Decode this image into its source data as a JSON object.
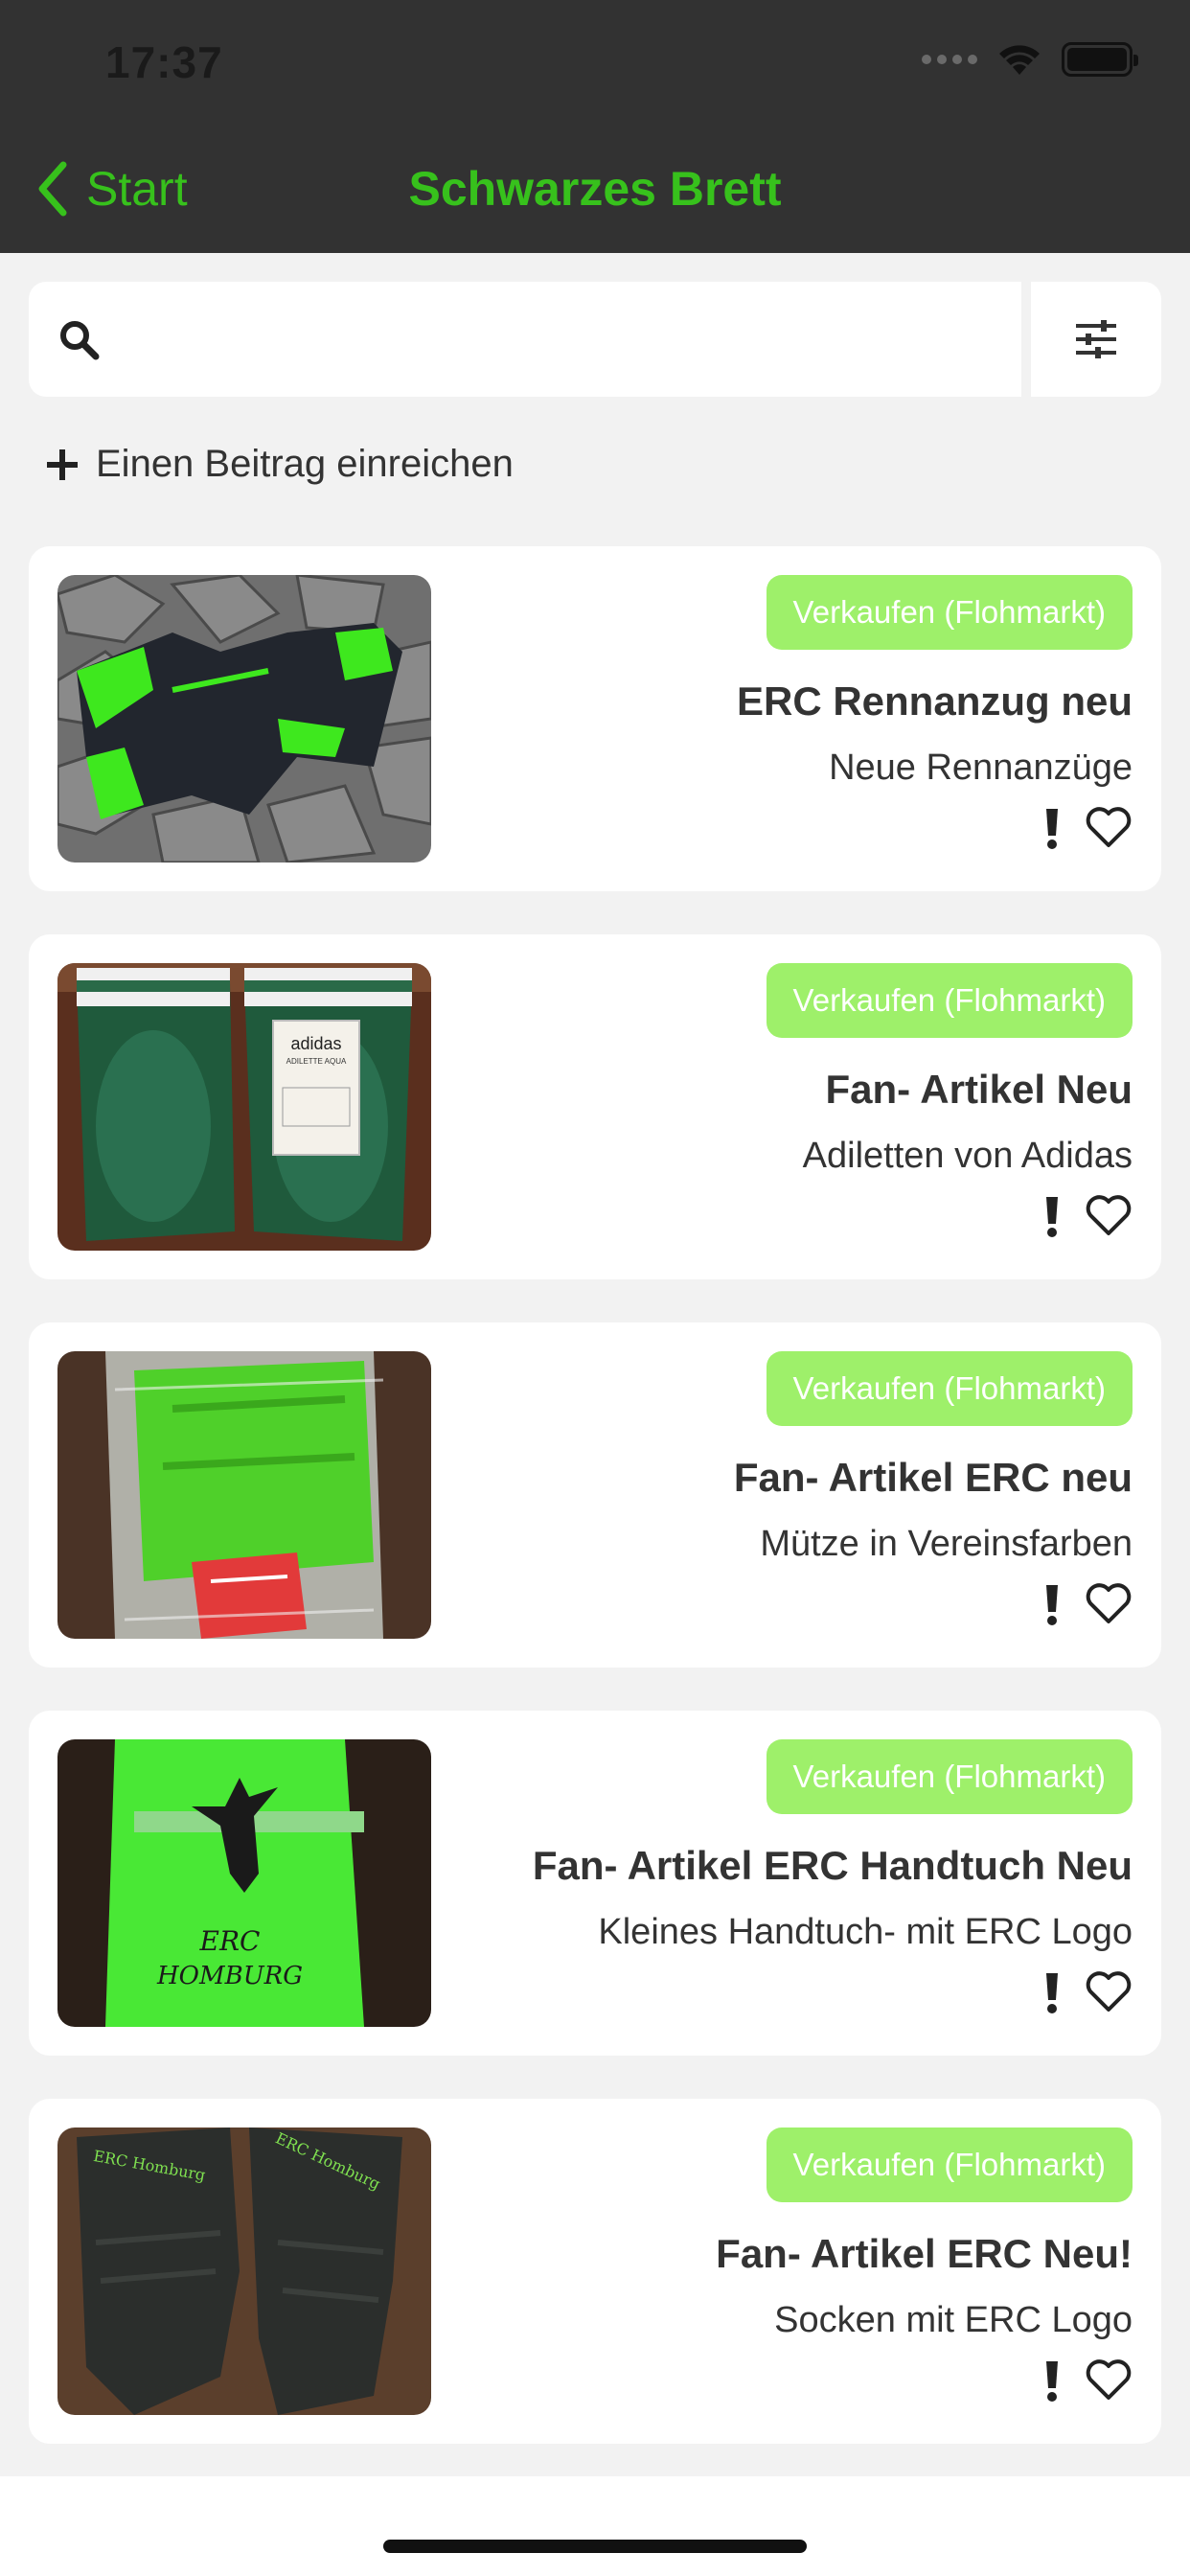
{
  "status_bar": {
    "time": "17:37"
  },
  "nav": {
    "back_label": "Start",
    "title": "Schwarzes Brett"
  },
  "search": {
    "placeholder": ""
  },
  "add_post_label": "Einen Beitrag einreichen",
  "colors": {
    "accent": "#37c11c",
    "badge": "#9ef06a",
    "topbar": "#323232"
  },
  "posts": [
    {
      "category": "Verkaufen (Flohmarkt)",
      "title": "ERC Rennanzug neu",
      "subtitle": "Neue Rennanzüge"
    },
    {
      "category": "Verkaufen (Flohmarkt)",
      "title": "Fan- Artikel Neu",
      "subtitle": "Adiletten von Adidas"
    },
    {
      "category": "Verkaufen (Flohmarkt)",
      "title": "Fan- Artikel ERC neu",
      "subtitle": "Mütze in Vereinsfarben"
    },
    {
      "category": "Verkaufen (Flohmarkt)",
      "title": "Fan- Artikel ERC Handtuch Neu",
      "subtitle": "Kleines Handtuch- mit ERC Logo"
    },
    {
      "category": "Verkaufen (Flohmarkt)",
      "title": "Fan- Artikel ERC Neu!",
      "subtitle": "Socken mit ERC Logo"
    }
  ],
  "thumb_text": {
    "adidas": "adidas",
    "adilette": "ADILETTE AQUA",
    "erc": "ERC",
    "homburg": "HOMBURG",
    "sock_left": "ERC Homburg",
    "sock_right": "ERC Homburg"
  },
  "icons": {
    "back": "chevron-left-icon",
    "search": "search-icon",
    "filter": "sliders-icon",
    "add": "plus-icon",
    "report": "exclamation-icon",
    "favorite": "heart-icon"
  }
}
